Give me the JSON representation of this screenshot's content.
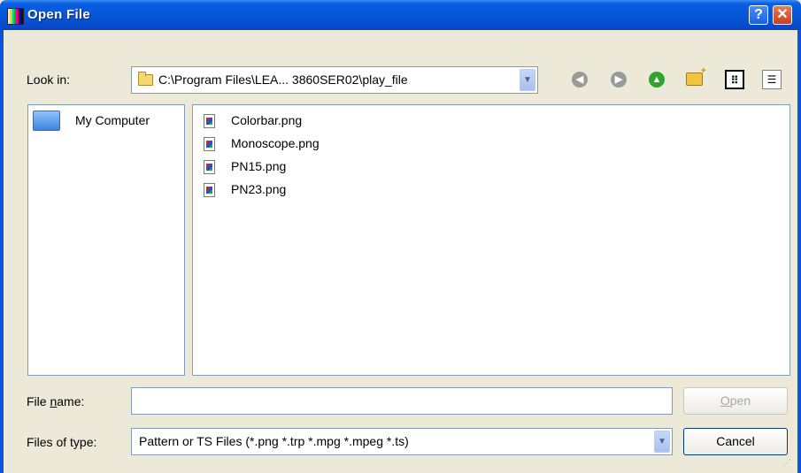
{
  "window": {
    "title": "Open File",
    "help_label": "?",
    "close_label": "✕"
  },
  "lookin": {
    "label": "Look in:",
    "path": "C:\\Program Files\\LEA... 3860SER02\\play_file"
  },
  "toolbar": {
    "icons": [
      "back-icon",
      "forward-icon",
      "up-folder-icon",
      "new-folder-icon",
      "list-view-icon",
      "details-view-icon"
    ]
  },
  "places": {
    "items": [
      {
        "label": "My Computer",
        "icon": "computer-icon"
      }
    ]
  },
  "files": [
    {
      "name": "Colorbar.png",
      "icon": "png-file-icon"
    },
    {
      "name": "Monoscope.png",
      "icon": "png-file-icon"
    },
    {
      "name": "PN15.png",
      "icon": "png-file-icon"
    },
    {
      "name": "PN23.png",
      "icon": "png-file-icon"
    }
  ],
  "filename": {
    "label_prefix": "File ",
    "label_underlined": "n",
    "label_suffix": "ame:",
    "value": "",
    "placeholder": ""
  },
  "filetype": {
    "label": "Files of type:",
    "selected": "Pattern or TS Files (*.png *.trp *.mpg *.mpeg *.ts)"
  },
  "buttons": {
    "open_underlined": "O",
    "open_rest": "pen",
    "cancel": "Cancel"
  },
  "colors": {
    "titlebar": "#0754d6",
    "window_bg": "#ece9d8",
    "field_border": "#7f9db9",
    "disabled_text": "#aca899"
  }
}
